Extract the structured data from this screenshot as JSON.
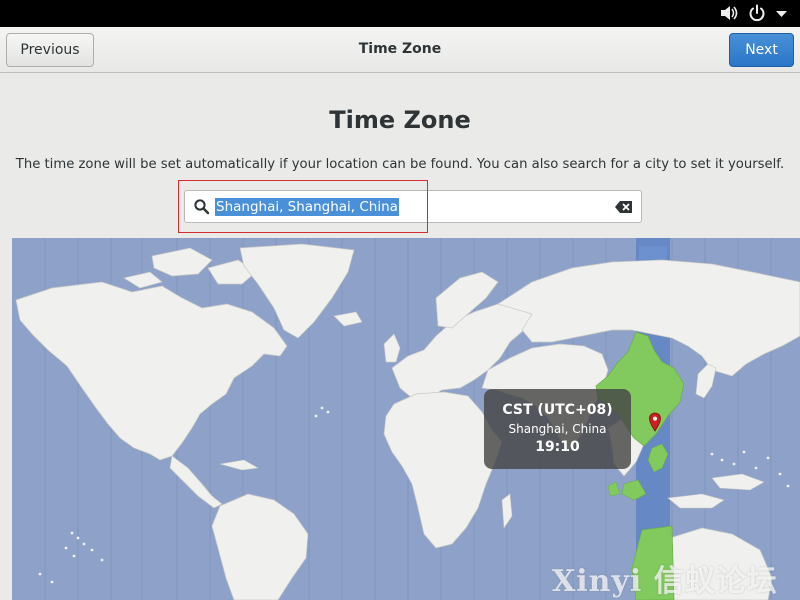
{
  "system_bar": {
    "icons": [
      "volume-icon",
      "power-icon",
      "dropdown-arrow-icon"
    ]
  },
  "header": {
    "previous_label": "Previous",
    "title": "Time Zone",
    "next_label": "Next"
  },
  "main": {
    "title": "Time Zone",
    "description": "The time zone will be set automatically if your location can be found. You can also search for a city to set it yourself.",
    "search": {
      "value": "Shanghai, Shanghai, China",
      "icon": "search-icon",
      "clear_icon": "clear-icon"
    }
  },
  "map": {
    "selected_timezone": {
      "name": "CST (UTC+08)",
      "city": "Shanghai, China",
      "time": "19:10"
    },
    "colors": {
      "ocean": "#8ea2c9",
      "land": "#f0f0ee",
      "selected_zone": "#82c95e",
      "selected_band": "#5f85c4"
    }
  },
  "watermark": "Xinyi 信蚁论坛"
}
